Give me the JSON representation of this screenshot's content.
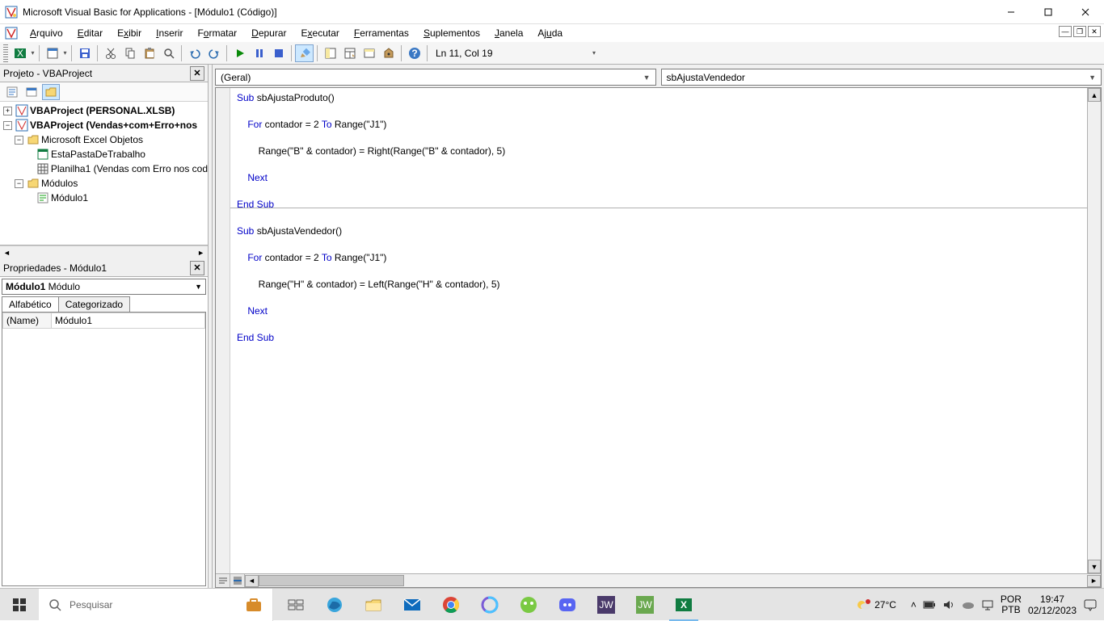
{
  "title": "Microsoft Visual Basic for Applications - [Módulo1 (Código)]",
  "menu": [
    "Arquivo",
    "Editar",
    "Exibir",
    "Inserir",
    "Formatar",
    "Depurar",
    "Executar",
    "Ferramentas",
    "Suplementos",
    "Janela",
    "Ajuda"
  ],
  "toolbar_status": "Ln 11, Col 19",
  "project_panel": {
    "title": "Projeto - VBAProject"
  },
  "tree": {
    "proj1": "VBAProject (PERSONAL.XLSB)",
    "proj2": "VBAProject (Vendas+com+Erro+nos",
    "excel_obj": "Microsoft Excel Objetos",
    "wb": "EstaPastaDeTrabalho",
    "sheet": "Planilha1 (Vendas com Erro nos cod",
    "mods": "Módulos",
    "mod1": "Módulo1"
  },
  "props_panel": {
    "title": "Propriedades - Módulo1"
  },
  "prop_combo": {
    "bold": "Módulo1",
    "type": "Módulo"
  },
  "prop_tabs": [
    "Alfabético",
    "Categorizado"
  ],
  "prop_row": {
    "name": "(Name)",
    "value": "Módulo1"
  },
  "combo_left": "(Geral)",
  "combo_right": "sbAjustaVendedor",
  "code": {
    "l1_a": "Sub",
    "l1_b": " sbAjustaProduto()",
    "l3_a": "    For",
    "l3_b": " contador = 2 ",
    "l3_c": "To",
    "l3_d": " Range(\"J1\")",
    "l5": "        Range(\"B\" & contador) = Right(Range(\"B\" & contador), 5)",
    "l7": "    Next",
    "l9": "End Sub",
    "l11_a": "Sub",
    "l11_b": " sbAjustaVendedor()",
    "l13_a": "    For",
    "l13_b": " contador = 2 ",
    "l13_c": "To",
    "l13_d": " Range(\"J1\")",
    "l15": "        Range(\"H\" & contador) = Left(Range(\"H\" & contador), 5)",
    "l17": "    Next",
    "l19": "End Sub"
  },
  "taskbar": {
    "search_placeholder": "Pesquisar",
    "temp": "27°C",
    "lang1": "POR",
    "lang2": "PTB",
    "time": "19:47",
    "date": "02/12/2023"
  }
}
